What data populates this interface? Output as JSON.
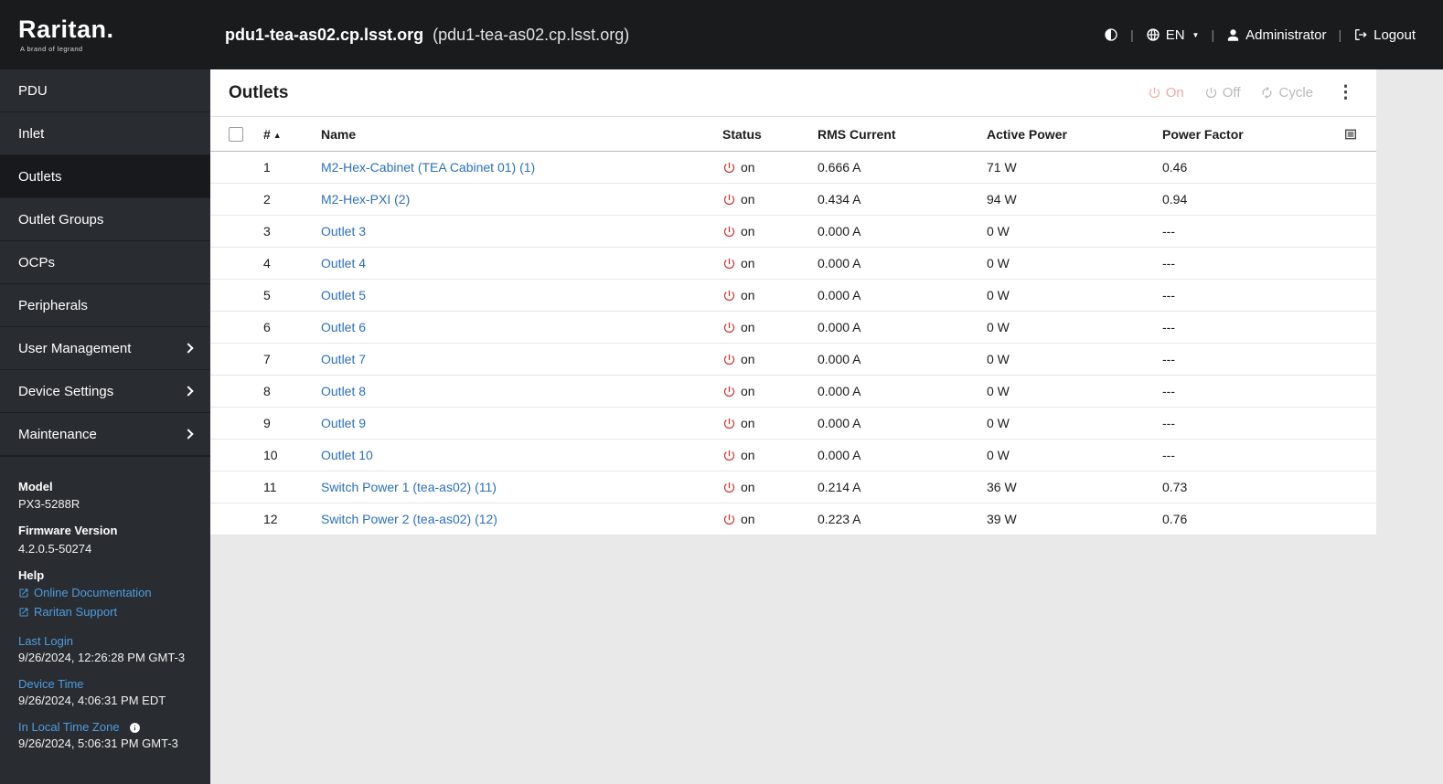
{
  "header": {
    "logo_text": "Raritan.",
    "logo_tagline": "A brand of legrand",
    "title": "pdu1-tea-as02.cp.lsst.org",
    "subtitle": "(pdu1-tea-as02.cp.lsst.org)",
    "language": "EN",
    "username": "Administrator",
    "logout_label": "Logout"
  },
  "sidebar": {
    "items": [
      {
        "label": "PDU"
      },
      {
        "label": "Inlet"
      },
      {
        "label": "Outlets"
      },
      {
        "label": "Outlet Groups"
      },
      {
        "label": "OCPs"
      },
      {
        "label": "Peripherals"
      },
      {
        "label": "User Management"
      },
      {
        "label": "Device Settings"
      },
      {
        "label": "Maintenance"
      }
    ],
    "info": {
      "model_label": "Model",
      "model_value": "PX3-5288R",
      "firmware_label": "Firmware Version",
      "firmware_value": "4.2.0.5-50274",
      "help_label": "Help",
      "doc_link": "Online Documentation",
      "support_link": "Raritan Support",
      "last_login_label": "Last Login",
      "last_login_value": "9/26/2024, 12:26:28 PM GMT-3",
      "device_time_label": "Device Time",
      "device_time_value": "9/26/2024, 4:06:31 PM EDT",
      "local_tz_label": "In Local Time Zone",
      "local_tz_value": "9/26/2024, 5:06:31 PM GMT-3"
    }
  },
  "main": {
    "page_title": "Outlets",
    "actions": {
      "on_label": "On",
      "off_label": "Off",
      "cycle_label": "Cycle"
    },
    "table": {
      "headers": {
        "num": "#",
        "name": "Name",
        "status": "Status",
        "rms_current": "RMS Current",
        "active_power": "Active Power",
        "power_factor": "Power Factor"
      },
      "rows": [
        {
          "num": "1",
          "name": "M2-Hex-Cabinet (TEA Cabinet 01) (1)",
          "status": "on",
          "rms_current": "0.666 A",
          "active_power": "71 W",
          "power_factor": "0.46"
        },
        {
          "num": "2",
          "name": "M2-Hex-PXI (2)",
          "status": "on",
          "rms_current": "0.434 A",
          "active_power": "94 W",
          "power_factor": "0.94"
        },
        {
          "num": "3",
          "name": "Outlet 3",
          "status": "on",
          "rms_current": "0.000 A",
          "active_power": "0 W",
          "power_factor": "---"
        },
        {
          "num": "4",
          "name": "Outlet 4",
          "status": "on",
          "rms_current": "0.000 A",
          "active_power": "0 W",
          "power_factor": "---"
        },
        {
          "num": "5",
          "name": "Outlet 5",
          "status": "on",
          "rms_current": "0.000 A",
          "active_power": "0 W",
          "power_factor": "---"
        },
        {
          "num": "6",
          "name": "Outlet 6",
          "status": "on",
          "rms_current": "0.000 A",
          "active_power": "0 W",
          "power_factor": "---"
        },
        {
          "num": "7",
          "name": "Outlet 7",
          "status": "on",
          "rms_current": "0.000 A",
          "active_power": "0 W",
          "power_factor": "---"
        },
        {
          "num": "8",
          "name": "Outlet 8",
          "status": "on",
          "rms_current": "0.000 A",
          "active_power": "0 W",
          "power_factor": "---"
        },
        {
          "num": "9",
          "name": "Outlet 9",
          "status": "on",
          "rms_current": "0.000 A",
          "active_power": "0 W",
          "power_factor": "---"
        },
        {
          "num": "10",
          "name": "Outlet 10",
          "status": "on",
          "rms_current": "0.000 A",
          "active_power": "0 W",
          "power_factor": "---"
        },
        {
          "num": "11",
          "name": "Switch Power 1 (tea-as02) (11)",
          "status": "on",
          "rms_current": "0.214 A",
          "active_power": "36 W",
          "power_factor": "0.73"
        },
        {
          "num": "12",
          "name": "Switch Power 2 (tea-as02) (12)",
          "status": "on",
          "rms_current": "0.223 A",
          "active_power": "39 W",
          "power_factor": "0.76"
        }
      ]
    }
  },
  "colors": {
    "status_on_red": "#d0342c",
    "link_blue": "#2a6fc0",
    "sidebar_link_blue": "#4e9ce0",
    "header_bg": "#191b1d",
    "sidebar_bg": "#292d31"
  }
}
